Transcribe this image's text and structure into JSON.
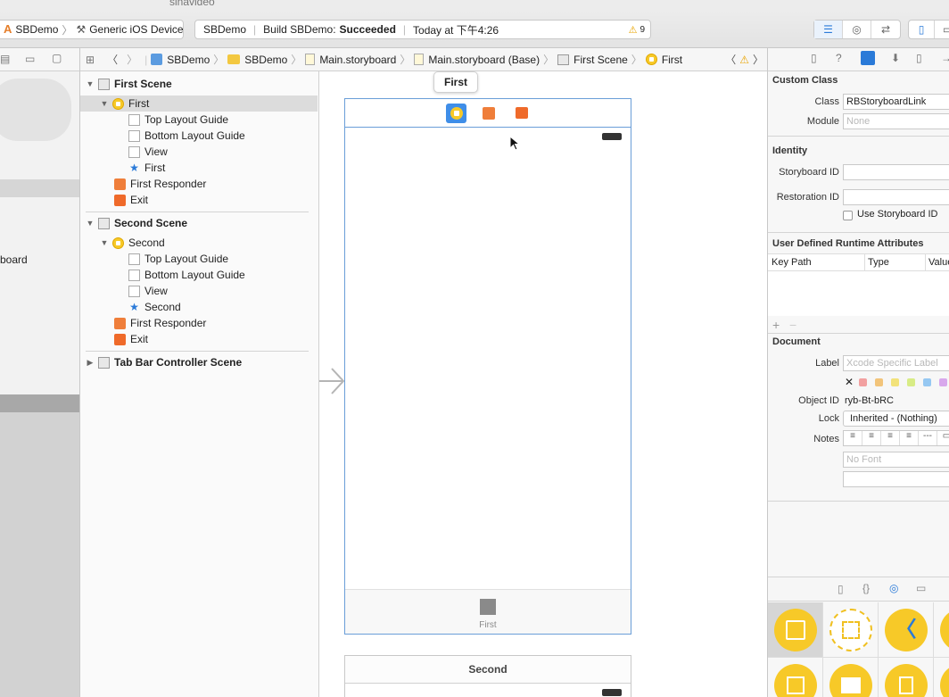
{
  "top_strip": {
    "tab_text": "sinavideo"
  },
  "toolbar": {
    "scheme_project": "SBDemo",
    "scheme_device": "Generic iOS Device",
    "activity_app": "SBDemo",
    "activity_build_prefix": "Build SBDemo:",
    "activity_build_status": "Succeeded",
    "activity_time": "Today at 下午4:26",
    "warning_count": "9"
  },
  "breadcrumb": {
    "items": [
      "SBDemo",
      "SBDemo",
      "Main.storyboard",
      "Main.storyboard (Base)",
      "First Scene",
      "First"
    ]
  },
  "left_panel": {
    "partial_label": "board"
  },
  "outline": {
    "first_scene": {
      "title": "First Scene",
      "controller": "First",
      "children": [
        "Top Layout Guide",
        "Bottom Layout Guide",
        "View",
        "First"
      ],
      "responder": "First Responder",
      "exit": "Exit"
    },
    "second_scene": {
      "title": "Second Scene",
      "controller": "Second",
      "children": [
        "Top Layout Guide",
        "Bottom Layout Guide",
        "View",
        "Second"
      ],
      "responder": "First Responder",
      "exit": "Exit"
    },
    "tab_bar_scene": {
      "title": "Tab Bar Controller Scene"
    }
  },
  "canvas": {
    "popover_title": "First",
    "tab_item_label": "First",
    "second_scene_title": "Second"
  },
  "inspector": {
    "custom_class": {
      "title": "Custom Class",
      "class_label": "Class",
      "class_value": "RBStoryboardLink",
      "module_label": "Module",
      "module_placeholder": "None"
    },
    "identity": {
      "title": "Identity",
      "storyboard_id_label": "Storyboard ID",
      "restoration_id_label": "Restoration ID",
      "use_storyboard_id_label": "Use Storyboard ID"
    },
    "runtime_attributes": {
      "title": "User Defined Runtime Attributes",
      "columns": [
        "Key Path",
        "Type",
        "Value"
      ]
    },
    "document": {
      "title": "Document",
      "label_label": "Label",
      "label_placeholder": "Xcode Specific Label",
      "object_id_label": "Object ID",
      "object_id_value": "ryb-Bt-bRC",
      "lock_label": "Lock",
      "lock_value": "Inherited - (Nothing)",
      "notes_label": "Notes",
      "font_placeholder": "No Font"
    },
    "label_colors": [
      "#f2a0a0",
      "#f2c47a",
      "#f2e27a",
      "#d8ec86",
      "#96c8f2",
      "#d8a8ec"
    ]
  },
  "colors": {
    "accent": "#2a7ad8",
    "vc_yellow": "#f7c928",
    "orange": "#ef7e3a",
    "selection_border": "#6a9ed8"
  }
}
